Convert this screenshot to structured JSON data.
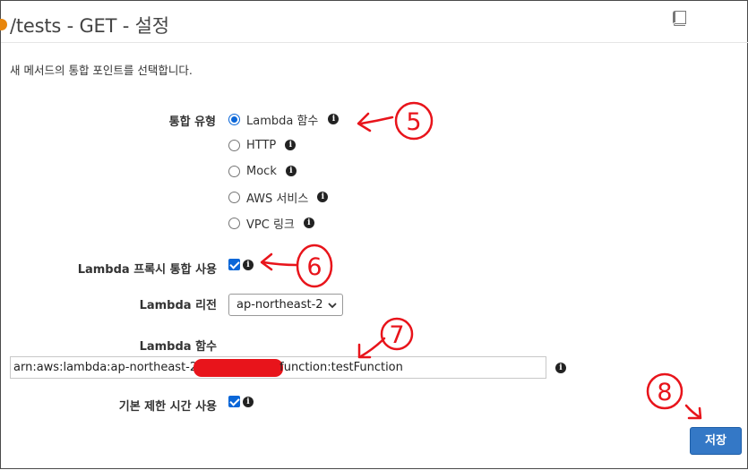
{
  "header": {
    "title": "/tests - GET - 설정"
  },
  "subtitle": "새 메서드의 통합 포인트를 선택합니다.",
  "integration_type": {
    "label": "통합 유형",
    "options": [
      {
        "label": "Lambda 함수",
        "checked": true
      },
      {
        "label": "HTTP",
        "checked": false
      },
      {
        "label": "Mock",
        "checked": false
      },
      {
        "label": "AWS 서비스",
        "checked": false
      },
      {
        "label": "VPC 링크",
        "checked": false
      }
    ]
  },
  "lambda_proxy": {
    "label": "Lambda 프록시 통합 사용",
    "checked": true
  },
  "lambda_region": {
    "label": "Lambda 리전",
    "selected": "ap-northeast-2"
  },
  "lambda_function": {
    "label": "Lambda 함수",
    "value_prefix": "arn:aws:lambda:ap-northeast-2",
    "value_suffix": "function:testFunction"
  },
  "default_timeout": {
    "label": "기본 제한 시간 사용",
    "checked": true
  },
  "save_button": "저장",
  "annotations": {
    "step5": "5",
    "step6": "6",
    "step7": "7",
    "step8": "8",
    "color": "#e8141b"
  },
  "colors": {
    "accent": "#0b67d8",
    "button": "#3478c6"
  }
}
